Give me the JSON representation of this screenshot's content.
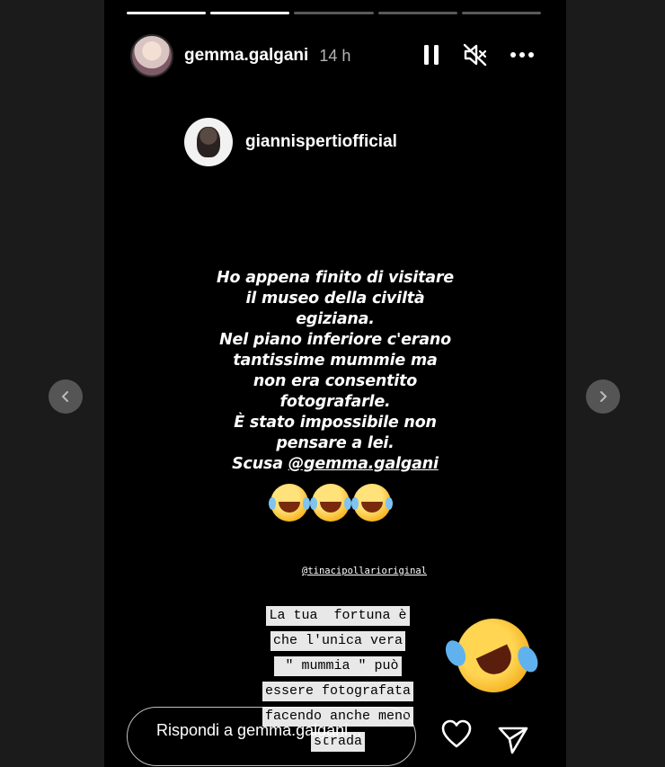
{
  "story": {
    "progress_total": 5,
    "progress_done": 2,
    "header": {
      "username": "gemma.galgani",
      "time": "14 h",
      "icons": [
        "pause-icon",
        "mute-icon",
        "more-icon"
      ]
    },
    "repost": {
      "username": "giannispertiofficial"
    },
    "caption": {
      "lines": [
        "Ho appena finito di visitare",
        "il museo della civiltà",
        "egiziana.",
        "Nel piano inferiore c'erano",
        "tantissime mummie ma",
        "non era consentito",
        "fotografarle.",
        "È stato impossibile non",
        "pensare a lei."
      ],
      "last_prefix": "Scusa ",
      "mention": "@gemma.galgani",
      "emojis": [
        "😂",
        "😂",
        "😂"
      ]
    },
    "tag": "@tinacipollarioriginal",
    "overlay_lines": [
      "La tua  fortuna è",
      "che l'unica vera",
      " \" mummia \" può",
      "essere fotografata",
      "facendo anche meno",
      "strada"
    ],
    "reply": {
      "placeholder": "Rispondi a gemma.galgani..."
    }
  },
  "colors": {
    "page_background": "#1b1b1b",
    "story_background": "#000000",
    "highlight_background": "#e8e8e8",
    "nav_button": "#555555"
  }
}
